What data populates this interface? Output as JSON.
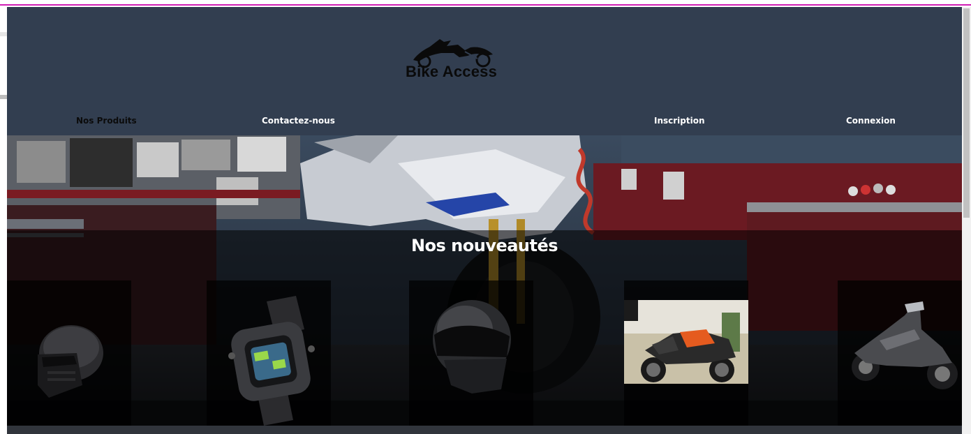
{
  "brand": {
    "name": "Bike Access"
  },
  "nav": {
    "items": [
      {
        "label": "Nos Produits"
      },
      {
        "label": "Contactez-nous"
      },
      {
        "label": "Inscription"
      },
      {
        "label": "Connexion"
      }
    ]
  },
  "news": {
    "title": "Nos nouveautés",
    "products": [
      {
        "icon": "modular-helmet-icon"
      },
      {
        "icon": "digital-watch-icon"
      },
      {
        "icon": "full-face-helmet-icon"
      },
      {
        "icon": "adventure-motorcycle-icon"
      },
      {
        "icon": "maxi-scooter-icon"
      }
    ]
  },
  "colors": {
    "header_bg": "#323e50",
    "accent_border": "#d11fb5",
    "nav_text": "#ffffff",
    "nav_active_text": "#0b0b0b"
  }
}
